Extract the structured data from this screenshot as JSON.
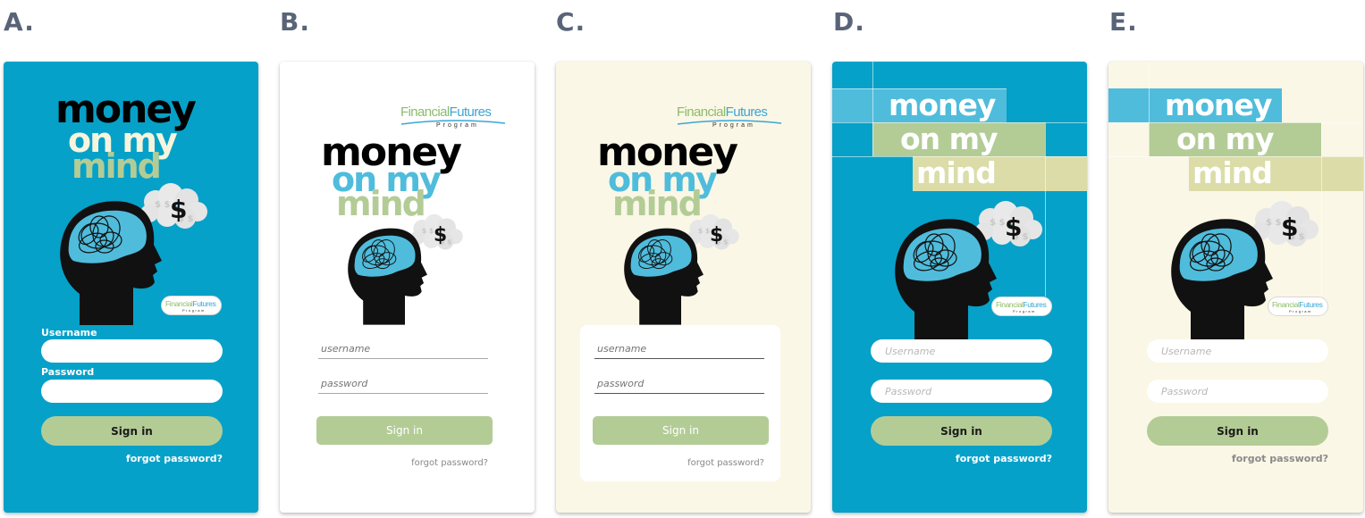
{
  "variants": [
    {
      "label": "A.",
      "headline": [
        "money",
        "on my",
        "mind"
      ],
      "username_label": "Username",
      "password_label": "Password",
      "username_value": "",
      "password_value": "",
      "sign_in": "Sign in",
      "forgot": "forgot password?"
    },
    {
      "label": "B.",
      "headline": [
        "money",
        "on my",
        "mind"
      ],
      "username_placeholder": "username",
      "password_placeholder": "password",
      "sign_in": "Sign in",
      "forgot": "forgot password?"
    },
    {
      "label": "C.",
      "headline": [
        "money",
        "on my",
        "mind"
      ],
      "username_placeholder": "username",
      "password_placeholder": "password",
      "sign_in": "Sign in",
      "forgot": "forgot password?"
    },
    {
      "label": "D.",
      "headline": [
        "money",
        "on my",
        "mind"
      ],
      "username_placeholder": "Username",
      "password_placeholder": "Password",
      "sign_in": "Sign in",
      "forgot": "forgot password?"
    },
    {
      "label": "E.",
      "headline": [
        "money",
        "on my",
        "mind"
      ],
      "username_placeholder": "Username",
      "password_placeholder": "Password",
      "sign_in": "Sign in",
      "forgot": "forgot password?"
    }
  ],
  "logo": {
    "financial": "Financial",
    "futures": "Futures",
    "program": "Program"
  },
  "illustration": {
    "thought_symbol": "$"
  },
  "colors": {
    "brand_blue": "#06a1c8",
    "light_blue": "#4fbcdc",
    "sage_green": "#b3cc96",
    "pale_olive": "#dcdca8",
    "cream": "#faf7e6",
    "label_gray": "#5a6478",
    "placeholder_blue": "#3a8fd6"
  }
}
